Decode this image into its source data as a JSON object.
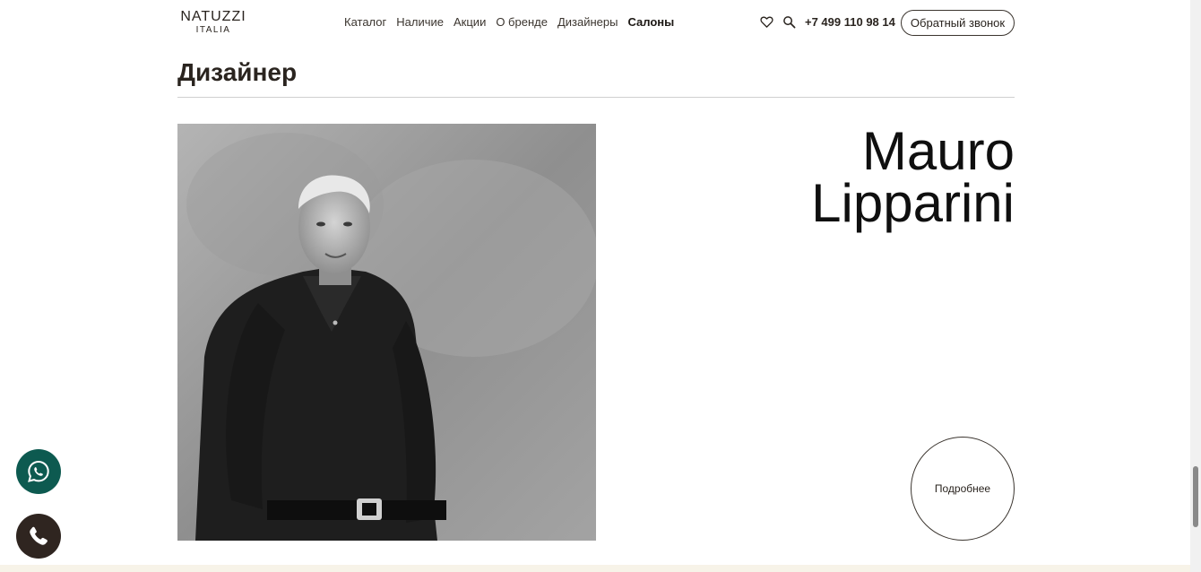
{
  "header": {
    "logo_main": "NATUZZI",
    "logo_sub": "ITALIA",
    "nav": [
      {
        "label": "Каталог",
        "active": false
      },
      {
        "label": "Наличие",
        "active": false
      },
      {
        "label": "Акции",
        "active": false
      },
      {
        "label": "О бренде",
        "active": false
      },
      {
        "label": "Дизайнеры",
        "active": false
      },
      {
        "label": "Салоны",
        "active": true
      }
    ],
    "phone": "+7 499 110 98 14",
    "callback_label": "Обратный звонок",
    "icons": [
      "heart-icon",
      "search-icon"
    ]
  },
  "section": {
    "title": "Дизайнер"
  },
  "designer": {
    "name_line1": "Mauro",
    "name_line2": "Lipparini",
    "more_label": "Подробнее"
  },
  "floating": {
    "whatsapp_icon": "whatsapp-icon",
    "call_icon": "phone-icon"
  },
  "colors": {
    "whatsapp": "#0d5a50",
    "call": "#2f2520",
    "footer": "#f7f3e8"
  }
}
